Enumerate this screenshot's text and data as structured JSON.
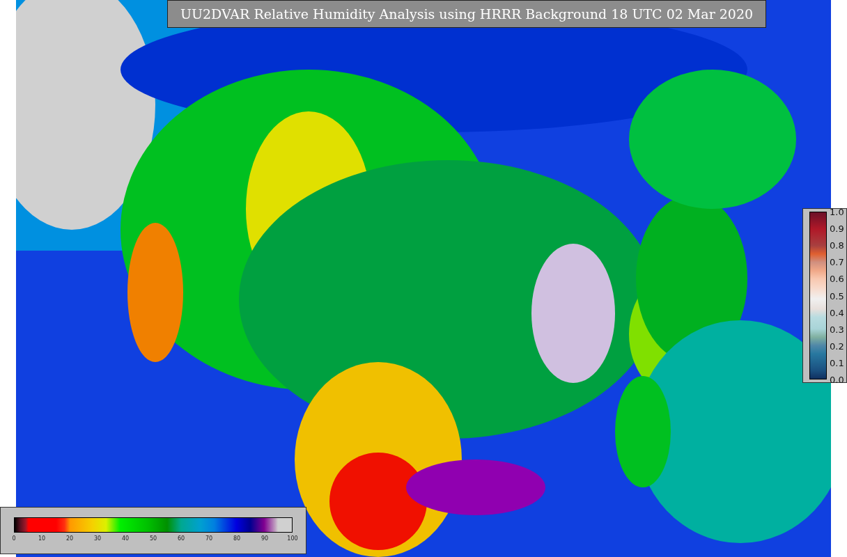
{
  "title": "UU2DVAR Relative Humidity Analysis using HRRR Background 18 UTC 02 Mar 2020",
  "humidity_scale": {
    "ticks": [
      "0",
      "10",
      "20",
      "30",
      "40",
      "50",
      "60",
      "70",
      "80",
      "90",
      "100"
    ]
  },
  "station_scale": {
    "ticks": [
      "1.0",
      "0.9",
      "0.8",
      "0.7",
      "0.6",
      "0.5",
      "0.4",
      "0.3",
      "0.2",
      "0.1",
      "0.0"
    ]
  }
}
